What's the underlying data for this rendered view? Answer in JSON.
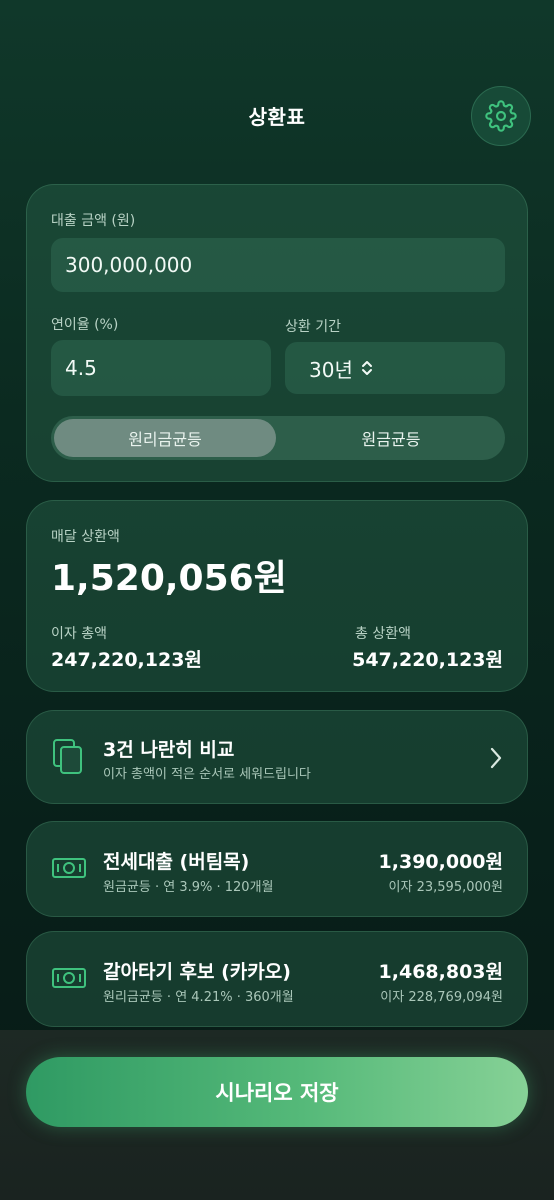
{
  "header": {
    "title": "상환표",
    "settings_icon": "gear-icon"
  },
  "input_card": {
    "loan_amount_label": "대출 금액 (원)",
    "loan_amount_value": "300,000,000",
    "rate_label": "연이율 (%)",
    "rate_value": "4.5",
    "term_label": "상환 기간",
    "term_value": "30년",
    "repayment_types": [
      {
        "label": "원리금균등",
        "selected": true
      },
      {
        "label": "원금균등",
        "selected": false
      }
    ]
  },
  "result_card": {
    "monthly_label": "매달 상환액",
    "monthly_value": "1,520,056원",
    "interest_total_label": "이자 총액",
    "interest_total_value": "247,220,123원",
    "repay_total_label": "총 상환액",
    "repay_total_value": "547,220,123원"
  },
  "compare_card": {
    "title": "3건 나란히 비교",
    "subtitle": "이자 총액이 적은 순서로 세워드립니다"
  },
  "scenarios": [
    {
      "title": "전세대출 (버팀목)",
      "detail": "원금균등 · 연 3.9% · 120개월",
      "amount": "1,390,000원",
      "interest": "이자 23,595,000원"
    },
    {
      "title": "갈아타기 후보 (카카오)",
      "detail": "원리금균등 · 연 4.21% · 360개월",
      "amount": "1,468,803원",
      "interest": "이자 228,769,094원"
    }
  ],
  "footer": {
    "save_label": "시나리오 저장"
  },
  "colors": {
    "accent": "#3fa86c",
    "icon_green": "#3fc27e",
    "background": "#0b2a20"
  }
}
